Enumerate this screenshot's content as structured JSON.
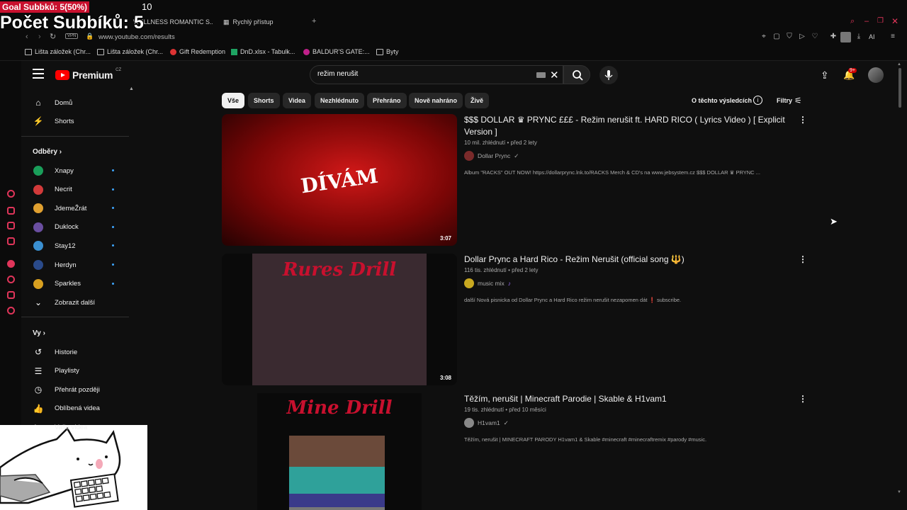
{
  "overlay": {
    "goal": "Goal Subbků: 5(50%)",
    "goal_target": "10",
    "count": "Počet Subbíků: 5"
  },
  "browser": {
    "tabs": [
      {
        "label": "WELLNESS ROMANTIC S..."
      },
      {
        "label": "Rychlý přístup"
      }
    ],
    "vpn": "VPN",
    "url": "www.youtube.com/results",
    "ai_label": "AI",
    "bookmarks": [
      "Lišta záložek (Chr...",
      "Lišta záložek (Chr...",
      "Gift Redemption",
      "DnD.xlsx - Tabulk...",
      "BALDUR'S GATE:...",
      "Byty"
    ]
  },
  "yt": {
    "logo": "Premium",
    "logo_country": "CZ",
    "search_value": "režim nerušit",
    "notif_badge": "9+",
    "chips": [
      "Vše",
      "Shorts",
      "Videa",
      "Nezhlédnuto",
      "Přehráno",
      "Nově nahráno",
      "Živě"
    ],
    "about": "O těchto výsledcích",
    "filters": "Filtry"
  },
  "sidebar": {
    "top": [
      {
        "label": "Domů",
        "icon": "home-icon"
      },
      {
        "label": "Shorts",
        "icon": "shorts-icon"
      }
    ],
    "subs_heading": "Odběry",
    "subs": [
      {
        "label": "Xnapy",
        "color": "#1a9e5a"
      },
      {
        "label": "Necrit",
        "color": "#d23a3a"
      },
      {
        "label": "JdemeŽrát",
        "color": "#e0a030"
      },
      {
        "label": "Duklock",
        "color": "#6a4ea0"
      },
      {
        "label": "Stay12",
        "color": "#3a8fd0"
      },
      {
        "label": "Herdyn",
        "color": "#2a4a8a"
      },
      {
        "label": "Sparkles",
        "color": "#d8a020"
      }
    ],
    "show_more": "Zobrazit další",
    "you_heading": "Vy",
    "you": [
      {
        "label": "Historie",
        "icon": "history-icon"
      },
      {
        "label": "Playlisty",
        "icon": "playlist-icon"
      },
      {
        "label": "Přehrát později",
        "icon": "clock-icon"
      },
      {
        "label": "Oblíbená videa",
        "icon": "thumb-up-icon"
      },
      {
        "label": "Vaše videa",
        "icon": "video-icon"
      }
    ]
  },
  "results": [
    {
      "title": "$$$ DOLLAR ♛ PRYNC £££ - Režim nerušit ft. HARD RICO ( Lyrics Video ) [ Explicit Version ]",
      "meta": "10 mil. zhlédnutí • před 2 lety",
      "channel": "Dollar Prync",
      "verified": "✓",
      "desc": "Album \"RACKS\" OUT NOW! https://dollarprync.lnk.to/RACKS Merch & CD's na www.jebsystem.cz $$$ DOLLAR ♛ PRYNC ...",
      "duration": "3:07",
      "thumb_text": "DÍVÁM",
      "thumb_color": "#8b0a0a"
    },
    {
      "title": "Dollar Prync a Hard Rico - Režim Nerušit (official song 🔱)",
      "meta": "116 tis. zhlédnutí • před 2 lety",
      "channel": "music mix",
      "verified": "♪",
      "desc": "další Nová pisnicka od Dollar Prync a Hard Rico režim nerušit nezapomen dát ❗ subscribe.",
      "duration": "3:08",
      "thumb_text": "Rures Drill",
      "thumb_color": "#2a2a2a"
    },
    {
      "title": "Těžím, nerušit | Minecraft Parodie | Skable & H1vam1",
      "meta": "19 tis. zhlédnutí • před 10 měsíci",
      "channel": "H1vam1",
      "verified": "✓",
      "desc": "Těžím, nerušit | MINECRAFT PARODY H1vam1 & Skable #minecraft #minecraftremix #parody #music.",
      "duration": "",
      "thumb_text": "Mine Drill",
      "thumb_color": "#0a0a0a"
    }
  ]
}
